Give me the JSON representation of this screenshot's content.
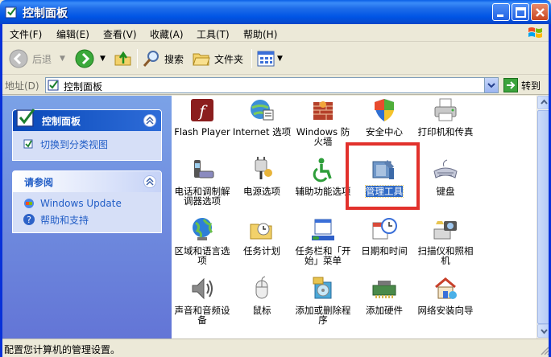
{
  "window": {
    "title": "控制面板"
  },
  "menu": [
    "文件(F)",
    "编辑(E)",
    "查看(V)",
    "收藏(A)",
    "工具(T)",
    "帮助(H)"
  ],
  "toolbar": {
    "back": "后退",
    "search": "搜索",
    "folders": "文件夹"
  },
  "address": {
    "label": "地址(D)",
    "value": "控制面板",
    "go": "转到"
  },
  "left": {
    "panel1_title": "控制面板",
    "panel1_link": "切换到分类视图",
    "panel2_title": "请参阅",
    "panel2_links": [
      "Windows Update",
      "帮助和支持"
    ]
  },
  "items": [
    "Flash Player",
    "Internet 选项",
    "Windows 防火墙",
    "安全中心",
    "打印机和传真",
    "电话和调制解调器选项",
    "电源选项",
    "辅助功能选项",
    "管理工具",
    "键盘",
    "区域和语言选项",
    "任务计划",
    "任务栏和「开始」菜单",
    "日期和时间",
    "扫描仪和照相机",
    "声音和音频设备",
    "鼠标",
    "添加或删除程序",
    "添加硬件",
    "网络安装向导"
  ],
  "status": {
    "text": "配置您计算机的管理设置。"
  }
}
